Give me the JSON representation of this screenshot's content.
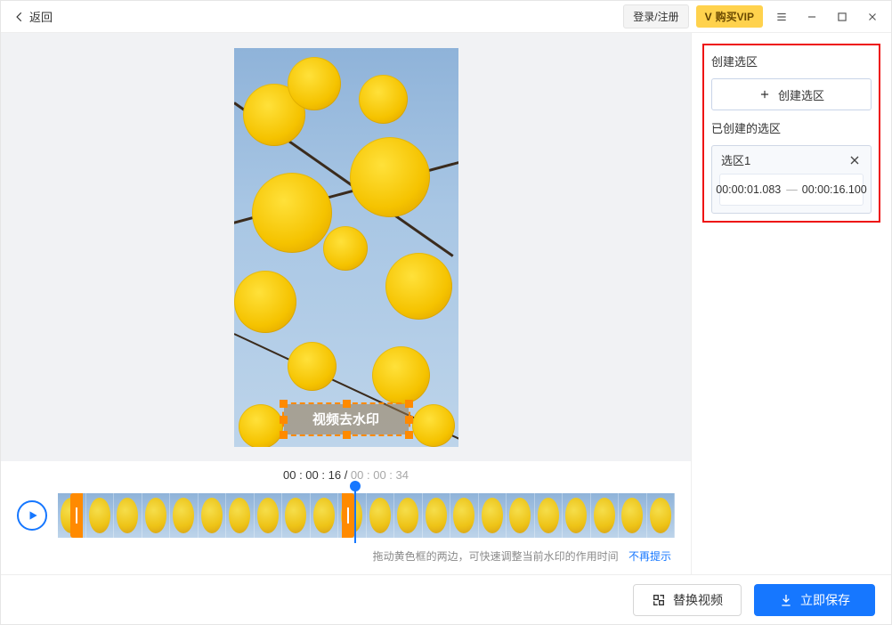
{
  "topbar": {
    "back_label": "返回",
    "login_label": "登录/注册",
    "vip_prefix": "V",
    "vip_label": "购买VIP"
  },
  "preview": {
    "watermark_text": "视频去水印"
  },
  "playback": {
    "current_time": "00 : 00 : 16",
    "separator": " / ",
    "duration": "00 : 00 : 34"
  },
  "hint": {
    "text": "拖动黄色框的两边，可快速调整当前水印的作用时间",
    "link": "不再提示"
  },
  "side": {
    "create_title": "创建选区",
    "create_button": "创建选区",
    "created_title": "已创建的选区",
    "zone": {
      "name": "选区1",
      "start": "00:00:01.083",
      "end": "00:00:16.100"
    }
  },
  "bottom": {
    "replace_label": "替换视频",
    "save_label": "立即保存"
  }
}
